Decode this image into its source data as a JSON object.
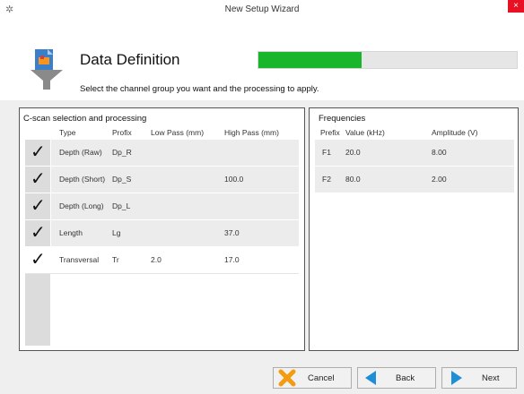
{
  "window": {
    "title": "New Setup Wizard",
    "close_label": "×",
    "app_icon": "wizard-icon"
  },
  "header": {
    "title": "Data Definition",
    "subtitle": "Select the channel group you want and the processing to apply.",
    "progress": 0.4,
    "progress_color": "#19b52a",
    "logo_icon": "funnel-icon"
  },
  "cscan": {
    "title": "C-scan selection and processing",
    "columns": [
      "Type",
      "Profix",
      "Low Pass (mm)",
      "High Pass (mm)"
    ],
    "rows": [
      {
        "checked": true,
        "type": "Depth (Raw)",
        "prefix": "Dp_R",
        "low": "",
        "high": ""
      },
      {
        "checked": true,
        "type": "Depth (Short)",
        "prefix": "Dp_S",
        "low": "",
        "high": "100.0"
      },
      {
        "checked": true,
        "type": "Depth (Long)",
        "prefix": "Dp_L",
        "low": "",
        "high": ""
      },
      {
        "checked": true,
        "type": "Length",
        "prefix": "Lg",
        "low": "",
        "high": "37.0"
      },
      {
        "checked": true,
        "type": "Transversal",
        "prefix": "Tr",
        "low": "2.0",
        "high": "17.0"
      }
    ]
  },
  "frequencies": {
    "title": "Frequencies",
    "columns": [
      "Prefix",
      "Value (kHz)",
      "Amplitude (V)"
    ],
    "rows": [
      {
        "prefix": "F1",
        "value": "20.0",
        "amplitude": "8.00"
      },
      {
        "prefix": "F2",
        "value": "80.0",
        "amplitude": "2.00"
      }
    ]
  },
  "footer": {
    "cancel_label": "Cancel",
    "back_label": "Back",
    "next_label": "Next",
    "accent": "#1e8fd6",
    "cancel_color": "#f39c12"
  }
}
